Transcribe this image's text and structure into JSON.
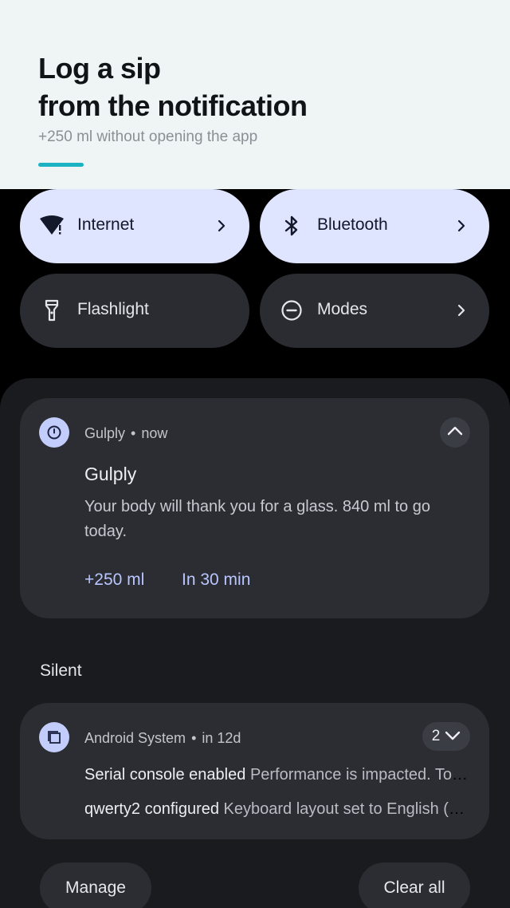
{
  "promo": {
    "title_line1": "Log a sip",
    "title_line2": "from the notification",
    "subtitle": "+250 ml without opening the app",
    "accent_color": "#1bb3c3"
  },
  "quick_settings": [
    {
      "label": "Internet",
      "icon": "wifi-alert-icon",
      "active": true,
      "has_chevron": true
    },
    {
      "label": "Bluetooth",
      "icon": "bluetooth-icon",
      "active": true,
      "has_chevron": true
    },
    {
      "label": "Flashlight",
      "icon": "flashlight-icon",
      "active": false,
      "has_chevron": false
    },
    {
      "label": "Modes",
      "icon": "minus-circle-icon",
      "active": false,
      "has_chevron": true
    }
  ],
  "notification": {
    "app": "Gulply",
    "time": "now",
    "title": "Gulply",
    "body": "Your body will thank you for a glass. 840 ml to go today.",
    "actions": [
      "+250 ml",
      "In 30 min"
    ]
  },
  "silent_header": "Silent",
  "system_group": {
    "app": "Android System",
    "time": "in 12d",
    "count": "2",
    "items": [
      {
        "title": "Serial console enabled",
        "text": "Performance is impacted. To disable, check bootloader."
      },
      {
        "title": "qwerty2 configured",
        "text": "Keyboard layout set to English (US)."
      }
    ]
  },
  "buttons": {
    "manage": "Manage",
    "clear_all": "Clear all"
  }
}
